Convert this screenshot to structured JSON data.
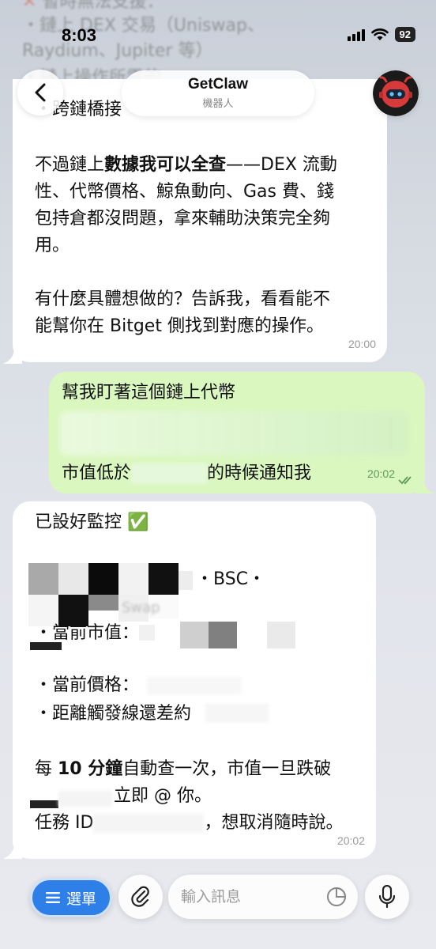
{
  "status_bar": {
    "time": "8:03",
    "battery": "92"
  },
  "header": {
    "title": "GetClaw",
    "subtitle": "機器人"
  },
  "background_ghost": {
    "line1": "暫時無法支援：",
    "line2": "・鏈上 DEX 交易（Uniswap、",
    "line3": "Raydium、Jupiter 等）",
    "line4": "・鏈上操作所需的",
    "line5": "・跨鏈橋接"
  },
  "messages": {
    "bot1": {
      "partial": "・跨鏈橋接",
      "p1_prefix": "不過鏈上",
      "p1_bold": "數據我可以全查",
      "p1_rest1": "——DEX 流動",
      "p1_line2": "性、代幣價格、鯨魚動向、Gas 費、錢",
      "p1_line3": "包持倉都沒問題，拿來輔助決策完全夠",
      "p1_line4": "用。",
      "p2_line1": "有什麼具體想做的？告訴我，看看能不",
      "p2_line2": "能幫你在 Bitget 側找到對應的操作。",
      "time": "20:00"
    },
    "user1": {
      "line1": "幫我盯著這個鏈上代幣",
      "line3_prefix": "市值低於",
      "line3_suffix": "的時候通知我",
      "time": "20:02"
    },
    "bot2": {
      "line1": "已設好監控 ✅",
      "chain": "・BSC・",
      "blurred_word": "Swap",
      "mcap_label": "・當前市值：",
      "price_label": "・當前價格：",
      "distance_label": "・距離觸發線還差約",
      "freq_prefix": "每 ",
      "freq_bold": "10 分鐘",
      "freq_rest": "自動查一次，市值一旦跌破",
      "notify": "立即 @ 你。",
      "task_prefix": "任務 ID",
      "task_suffix": "，想取消隨時說。",
      "time": "20:02"
    }
  },
  "composer": {
    "menu_label": "選單",
    "placeholder": "輸入訊息"
  },
  "colors": {
    "accent": "#2f7fe8",
    "outgoing_bubble": "#dbf7c0",
    "incoming_bubble": "#ffffff",
    "check_green": "#5d9a58"
  },
  "icons": {
    "back": "chevron-left-icon",
    "attach": "paperclip-icon",
    "sticker": "sticker-icon",
    "mic": "microphone-icon",
    "menu": "hamburger-icon",
    "read": "double-check-icon",
    "avatar": "robot-avatar-icon"
  }
}
